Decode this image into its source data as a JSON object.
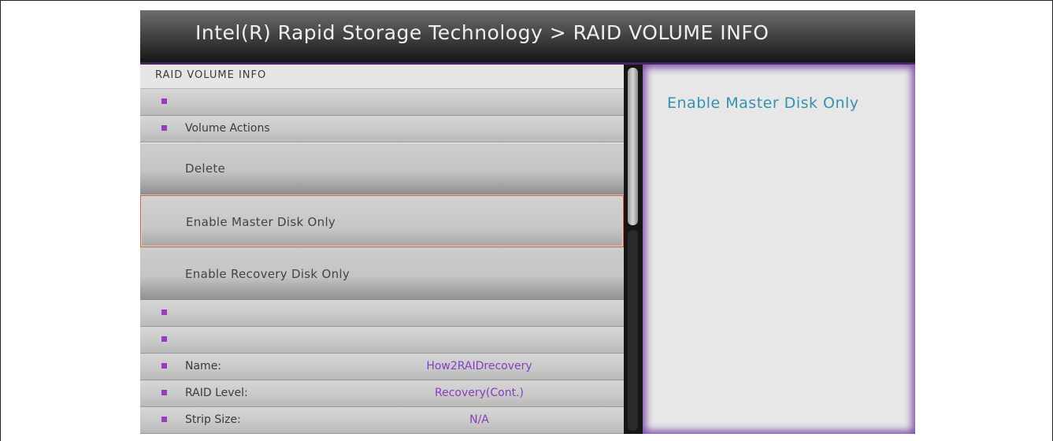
{
  "window": {
    "title": "Intel(R) Rapid Storage Technology > RAID VOLUME INFO"
  },
  "panel": {
    "header": "RAID VOLUME INFO",
    "items": [
      {
        "label": ""
      },
      {
        "label": "Volume Actions"
      }
    ],
    "actions": [
      {
        "label": "Delete"
      },
      {
        "label": "Enable Master Disk Only"
      },
      {
        "label": "Enable Recovery Disk Only"
      }
    ],
    "blank_items": [
      {
        "label": ""
      },
      {
        "label": ""
      }
    ],
    "info_rows": [
      {
        "label": "Name:",
        "value": "How2RAIDrecovery"
      },
      {
        "label": "RAID Level:",
        "value": "Recovery(Cont.)"
      },
      {
        "label": "Strip Size:",
        "value": "N/A"
      }
    ]
  },
  "help": {
    "text": "Enable Master Disk Only"
  },
  "colors": {
    "bullet": "#9a3cc2",
    "value_text": "#8a3cc0",
    "help_text": "#3592b0",
    "selected_border": "#c8643c"
  }
}
